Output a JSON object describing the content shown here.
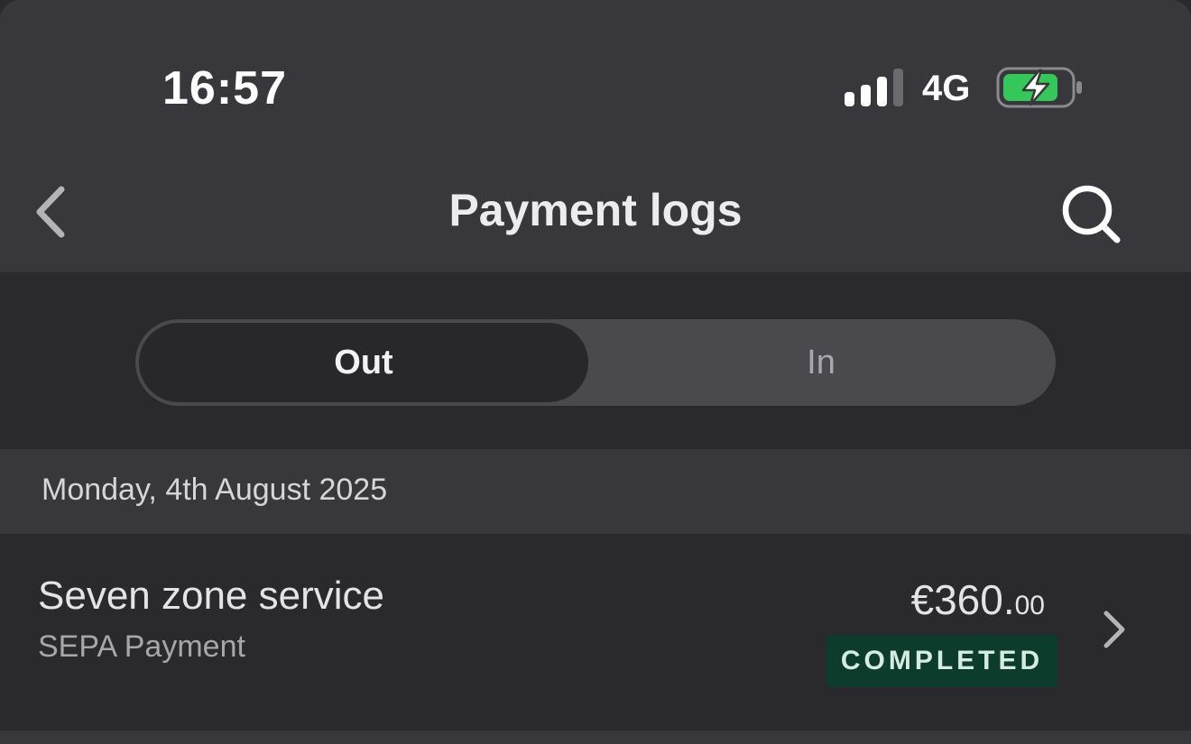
{
  "status_bar": {
    "time": "16:57",
    "network": "4G",
    "signal_icon": "signal-bars-icon",
    "battery_icon": "battery-charging-icon"
  },
  "nav": {
    "title": "Payment logs",
    "back_icon": "chevron-left-icon",
    "search_icon": "search-icon"
  },
  "segments": {
    "out_label": "Out",
    "in_label": "In",
    "selected": "Out"
  },
  "log": {
    "date_header": "Monday, 4th August 2025",
    "entries": [
      {
        "payee": "Seven zone service",
        "method": "SEPA Payment",
        "amount_main": "€360.",
        "amount_cents": "00",
        "status": "COMPLETED",
        "chevron_icon": "chevron-right-icon"
      }
    ]
  },
  "colors": {
    "header_bg": "#38373b",
    "page_bg": "#2a292d",
    "badge_bg": "#0c3d2c",
    "battery_green": "#34c759"
  }
}
